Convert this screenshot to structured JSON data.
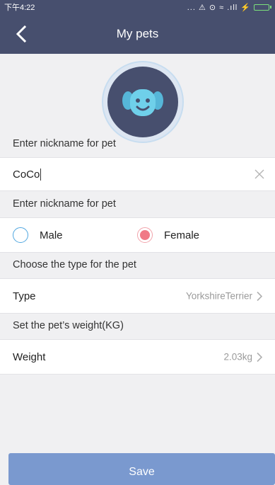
{
  "status_bar": {
    "time": "下午4:22",
    "icons": "... ⚠ ⊙ ≈ .ıll ⚡"
  },
  "nav": {
    "title": "My pets",
    "back_icon": "chevron-left-icon"
  },
  "avatar": {
    "icon": "dog-face-icon"
  },
  "sections": {
    "nickname_header": "Enter nickname for pet",
    "gender_header": "Enter nickname for pet",
    "type_header": "Choose the type for the pet",
    "weight_header": "Set the pet’s weight(KG)"
  },
  "nickname": {
    "value": "CoCo"
  },
  "gender": {
    "male_label": "Male",
    "female_label": "Female",
    "selected": "Female"
  },
  "type": {
    "label": "Type",
    "value": "YorkshireTerrier"
  },
  "weight": {
    "label": "Weight",
    "value": "2.03kg"
  },
  "save_button": "Save",
  "colors": {
    "header_bg": "#474f6e",
    "page_bg": "#f0f0f2",
    "radio_selected": "#f07a86",
    "radio_unselected": "#4fa6e0",
    "save_bg": "#7a99cf"
  }
}
